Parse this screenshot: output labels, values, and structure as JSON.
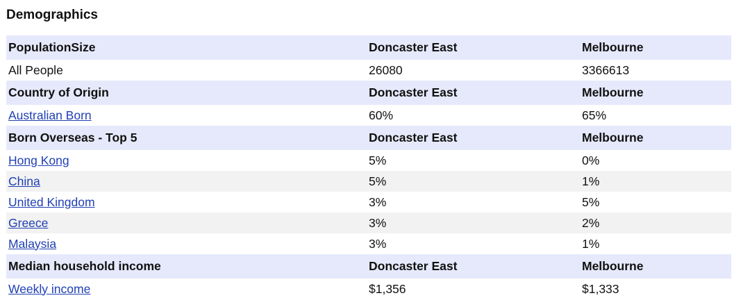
{
  "title": "Demographics",
  "colors": {
    "header_bg": "#e6e9fb",
    "alt_row_bg": "#f2f2f2",
    "link": "#1f3fb3"
  },
  "sections": [
    {
      "header": [
        "PopulationSize",
        "Doncaster East",
        "Melbourne"
      ],
      "rows": [
        {
          "label": "All People",
          "link": false,
          "local": "26080",
          "region": "3366613"
        }
      ]
    },
    {
      "header": [
        "Country of Origin",
        "Doncaster East",
        "Melbourne"
      ],
      "rows": [
        {
          "label": "Australian Born",
          "link": true,
          "local": "60%",
          "region": "65%"
        }
      ]
    },
    {
      "header": [
        "Born Overseas - Top 5",
        "Doncaster East",
        "Melbourne"
      ],
      "rows": [
        {
          "label": "Hong Kong",
          "link": true,
          "local": "5%",
          "region": "0%"
        },
        {
          "label": "China",
          "link": true,
          "local": "5%",
          "region": "1%"
        },
        {
          "label": "United Kingdom",
          "link": true,
          "local": "3%",
          "region": "5%"
        },
        {
          "label": "Greece",
          "link": true,
          "local": "3%",
          "region": "2%"
        },
        {
          "label": "Malaysia",
          "link": true,
          "local": "3%",
          "region": "1%"
        }
      ]
    },
    {
      "header": [
        "Median household income",
        "Doncaster East",
        "Melbourne"
      ],
      "rows": [
        {
          "label": "Weekly income",
          "link": true,
          "local": "$1,356",
          "region": "$1,333"
        }
      ]
    }
  ]
}
